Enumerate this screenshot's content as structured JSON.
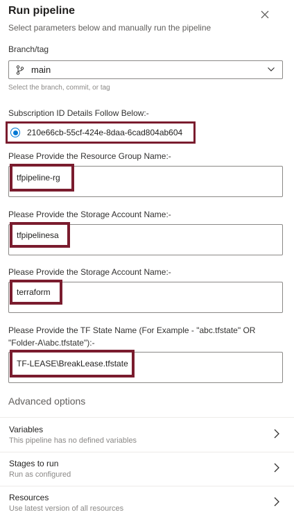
{
  "header": {
    "title": "Run pipeline",
    "subtitle": "Select parameters below and manually run the pipeline"
  },
  "branch": {
    "label": "Branch/tag",
    "value": "main",
    "helper": "Select the branch, commit, or tag"
  },
  "subscription": {
    "label": "Subscription ID Details Follow Below:-",
    "option": "210e66cb-55cf-424e-8daa-6cad804ab604",
    "selected": true
  },
  "fields": [
    {
      "label": "Please Provide the Resource Group Name:-",
      "value": "tfpipeline-rg"
    },
    {
      "label": "Please Provide the Storage Account Name:-",
      "value": "tfpipelinesa"
    },
    {
      "label": "Please Provide the Storage Account Name:-",
      "value": "terraform"
    },
    {
      "label_line1": "Please Provide the TF State Name (For Example - \"abc.tfstate\" OR",
      "label_line2": "\"Folder-A\\abc.tfstate\"):-",
      "value": "TF-LEASE\\BreakLease.tfstate"
    }
  ],
  "advanced": {
    "title": "Advanced options",
    "rows": [
      {
        "title": "Variables",
        "subtitle": "This pipeline has no defined variables"
      },
      {
        "title": "Stages to run",
        "subtitle": "Run as configured"
      },
      {
        "title": "Resources",
        "subtitle": "Use latest version of all resources"
      }
    ]
  },
  "colors": {
    "accent": "#0078d4",
    "highlight": "#7a1c2e",
    "border": "#8a8886"
  },
  "icons": [
    "close-icon",
    "branch-icon",
    "chevron-down-icon",
    "chevron-right-icon"
  ]
}
